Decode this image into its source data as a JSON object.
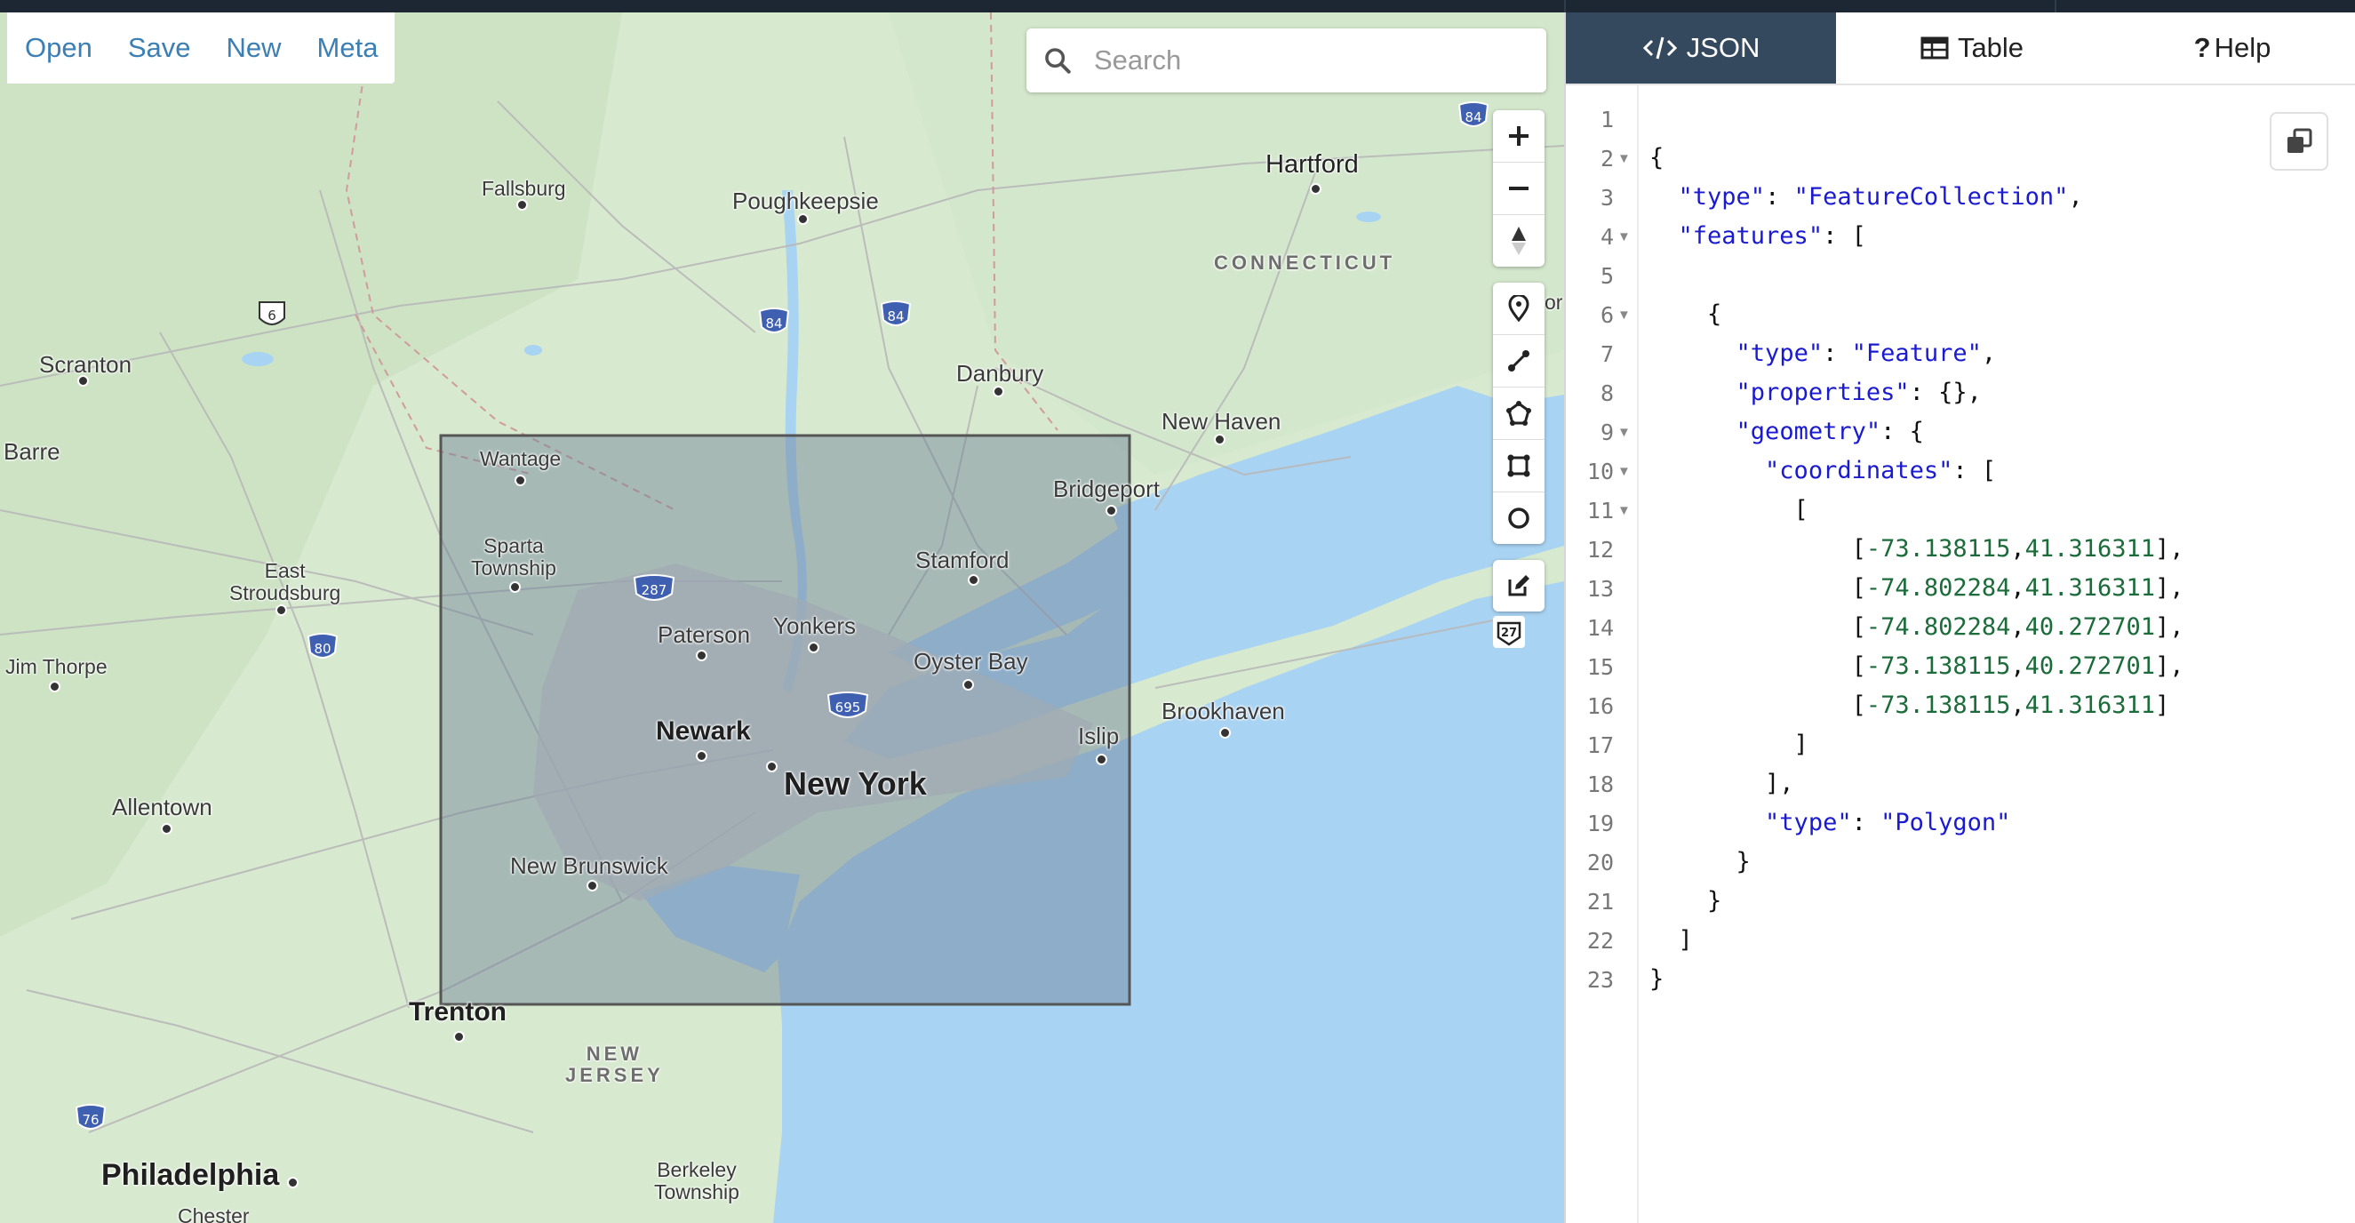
{
  "menu": {
    "open": "Open",
    "save": "Save",
    "new": "New",
    "meta": "Meta"
  },
  "search": {
    "placeholder": "Search",
    "icon": "search-icon"
  },
  "map_controls": {
    "zoom_in": "zoom-in-icon",
    "zoom_out": "zoom-out-icon",
    "compass": "compass-icon",
    "draw_point": "marker-icon",
    "draw_line": "line-icon",
    "draw_polygon": "polygon-icon",
    "draw_rectangle": "rectangle-icon",
    "draw_circle": "circle-icon",
    "edit": "edit-icon"
  },
  "map": {
    "labels": {
      "fallsburg": "Fallsburg",
      "poughkeepsie": "Poughkeepsie",
      "hartford": "Hartford",
      "connecticut": "CONNECTICUT",
      "scranton": "Scranton",
      "danbury": "Danbury",
      "new_haven": "New Haven",
      "barre": "Barre",
      "wantage": "Wantage",
      "bridgeport": "Bridgeport",
      "sparta_township": "Sparta\nTownship",
      "east_stroudsburg": "East\nStroudsburg",
      "stamford": "Stamford",
      "paterson": "Paterson",
      "yonkers": "Yonkers",
      "oyster_bay": "Oyster Bay",
      "jim_thorpe": "Jim Thorpe",
      "brookhaven": "Brookhaven",
      "newark": "Newark",
      "islip": "Islip",
      "new_york": "New York",
      "allentown": "Allentown",
      "new_brunswick": "New Brunswick",
      "trenton": "Trenton",
      "new_jersey": "NEW\nJERSEY",
      "philadelphia": "Philadelphia",
      "berkeley_township": "Berkeley\nTownship",
      "chester": "Chester",
      "or_fragment": "or"
    },
    "shields": {
      "i84a": "84",
      "i84b": "84",
      "i84c": "84",
      "us6": "6",
      "i287": "287",
      "i80": "80",
      "i695": "695",
      "i76": "76",
      "badge": "27"
    }
  },
  "tabs": {
    "json": "JSON",
    "table": "Table",
    "help": "Help"
  },
  "json_lines": [
    {
      "n": "1",
      "fold": "",
      "text": ""
    },
    {
      "n": "2",
      "fold": "▼",
      "text": "{"
    },
    {
      "n": "3",
      "fold": "",
      "text": "  \"type\": \"FeatureCollection\","
    },
    {
      "n": "4",
      "fold": "▼",
      "text": "  \"features\": ["
    },
    {
      "n": "5",
      "fold": "",
      "text": ""
    },
    {
      "n": "6",
      "fold": "▼",
      "text": "    {"
    },
    {
      "n": "7",
      "fold": "",
      "text": "      \"type\": \"Feature\","
    },
    {
      "n": "8",
      "fold": "",
      "text": "      \"properties\": {},"
    },
    {
      "n": "9",
      "fold": "▼",
      "text": "      \"geometry\": {"
    },
    {
      "n": "10",
      "fold": "▼",
      "text": "        \"coordinates\": ["
    },
    {
      "n": "11",
      "fold": "▼",
      "text": "          ["
    },
    {
      "n": "12",
      "fold": "",
      "text": "              [-73.138115,41.316311],"
    },
    {
      "n": "13",
      "fold": "",
      "text": "              [-74.802284,41.316311],"
    },
    {
      "n": "14",
      "fold": "",
      "text": "              [-74.802284,40.272701],"
    },
    {
      "n": "15",
      "fold": "",
      "text": "              [-73.138115,40.272701],"
    },
    {
      "n": "16",
      "fold": "",
      "text": "              [-73.138115,41.316311]"
    },
    {
      "n": "17",
      "fold": "",
      "text": "          ]"
    },
    {
      "n": "18",
      "fold": "",
      "text": "        ],"
    },
    {
      "n": "19",
      "fold": "",
      "text": "        \"type\": \"Polygon\""
    },
    {
      "n": "20",
      "fold": "",
      "text": "      }"
    },
    {
      "n": "21",
      "fold": "",
      "text": "    }"
    },
    {
      "n": "22",
      "fold": "",
      "text": "  ]"
    },
    {
      "n": "23",
      "fold": "",
      "text": "}"
    }
  ],
  "colors": {
    "accent": "#3b7fb4",
    "active_tab": "#34495e",
    "water": "#a9d3f2",
    "land": "#d9ead0",
    "polygon_fill": "#6b7f95"
  }
}
